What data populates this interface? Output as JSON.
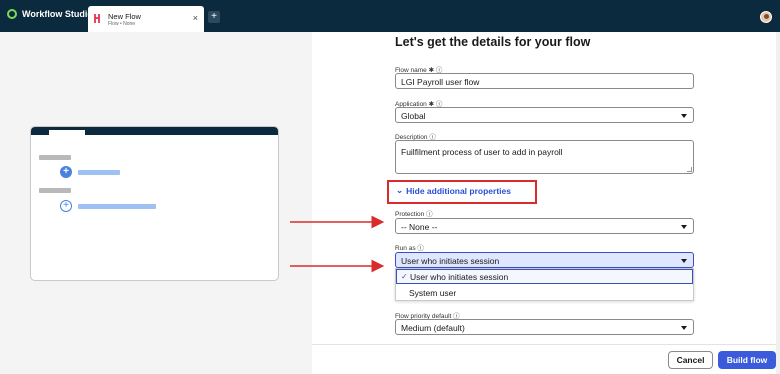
{
  "app": {
    "name": "Workflow Studio"
  },
  "tab": {
    "title": "New Flow",
    "subtitle": "Flow • None",
    "close": "×",
    "add": "+"
  },
  "form": {
    "title": "Let's get the details for your flow",
    "flow_name": {
      "label": "Flow name",
      "value": "LGI Payroll user flow"
    },
    "application": {
      "label": "Application",
      "value": "Global"
    },
    "description": {
      "label": "Description",
      "value": "Fuilfilment process of user to add in payroll"
    },
    "toggle": "Hide additional properties",
    "protection": {
      "label": "Protection",
      "value": "-- None --"
    },
    "run_as": {
      "label": "Run as",
      "value": "User who initiates session",
      "options": [
        "User who initiates session",
        "System user"
      ]
    },
    "priority": {
      "label": "Flow priority default",
      "value": "Medium (default)"
    },
    "cancel_label": "Cancel",
    "build_label": "Build flow"
  },
  "colors": {
    "topbar": "#0b2a3d",
    "primary": "#3b5bdb",
    "annotation": "#d92b2b",
    "link": "#2b4fd6"
  }
}
